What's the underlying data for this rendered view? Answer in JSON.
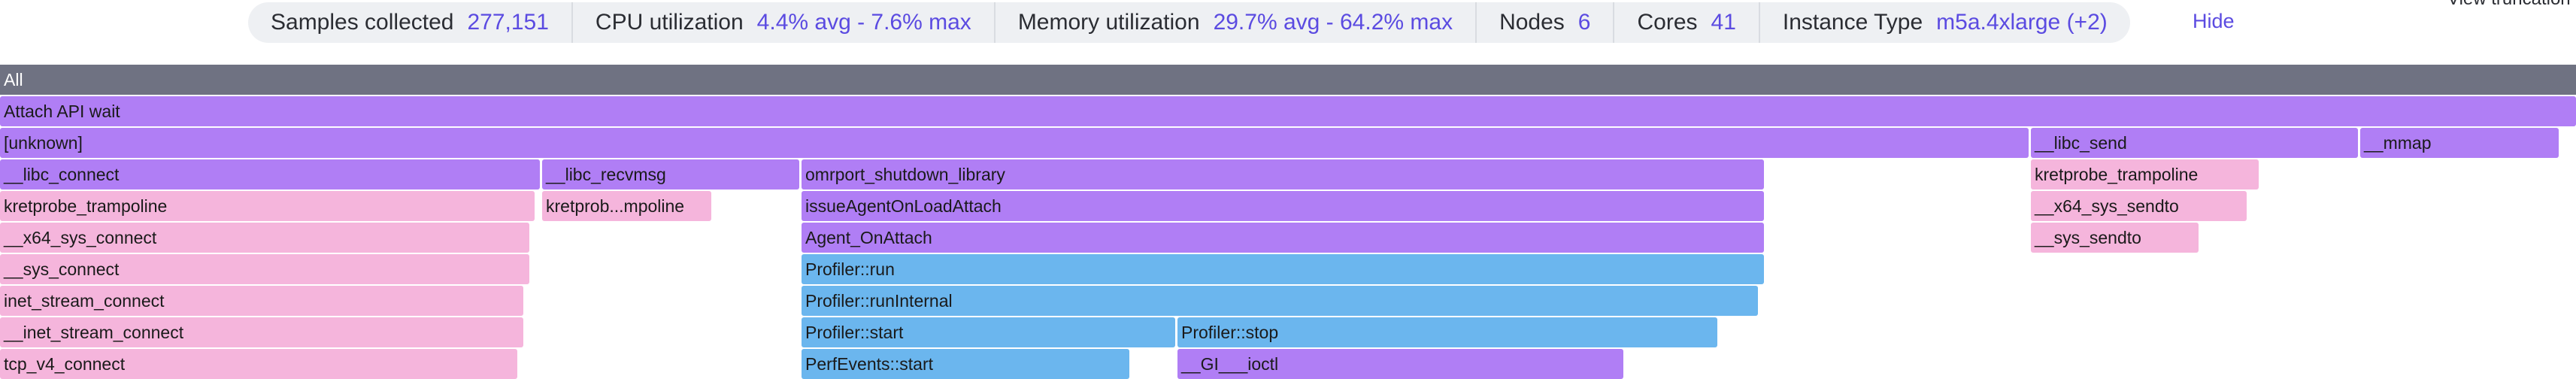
{
  "stats": [
    {
      "name": "samples",
      "label": "Samples collected",
      "value": "277,151"
    },
    {
      "name": "cpu",
      "label": "CPU utilization",
      "value": "4.4% avg - 7.6% max"
    },
    {
      "name": "memory",
      "label": "Memory utilization",
      "value": "29.7% avg - 64.2% max"
    },
    {
      "name": "nodes",
      "label": "Nodes",
      "value": "6"
    },
    {
      "name": "cores",
      "label": "Cores",
      "value": "41"
    },
    {
      "name": "instance-type",
      "label": "Instance Type",
      "value": "m5a.4xlarge (+2)"
    }
  ],
  "hide_label": "Hide",
  "view_truncation_label": "View truncation",
  "colors": {
    "root": "#6f7282",
    "purple": "#b07ef5",
    "pink": "#f5b5dc",
    "blue": "#6bb6ee",
    "accent": "#5b4be1"
  },
  "flamegraph": {
    "root": "All",
    "rows": [
      [
        {
          "label": "Attach API wait",
          "color": "purple"
        }
      ],
      [
        {
          "label": "[unknown]",
          "color": "purple"
        },
        {
          "label": "__libc_send",
          "color": "purple"
        },
        {
          "label": "__mmap",
          "color": "purple"
        }
      ],
      [
        {
          "label": "__libc_connect",
          "color": "purple"
        },
        {
          "label": "__libc_recvmsg",
          "color": "purple"
        },
        {
          "label": "omrport_shutdown_library",
          "color": "purple"
        },
        {
          "label": "kretprobe_trampoline",
          "color": "pink"
        }
      ],
      [
        {
          "label": "kretprobe_trampoline",
          "color": "pink"
        },
        {
          "label": "kretprob...mpoline",
          "color": "pink"
        },
        {
          "label": "issueAgentOnLoadAttach",
          "color": "purple"
        },
        {
          "label": "__x64_sys_sendto",
          "color": "pink"
        }
      ],
      [
        {
          "label": "__x64_sys_connect",
          "color": "pink"
        },
        {
          "label": "Agent_OnAttach",
          "color": "purple"
        },
        {
          "label": "__sys_sendto",
          "color": "pink"
        }
      ],
      [
        {
          "label": "__sys_connect",
          "color": "pink"
        },
        {
          "label": "Profiler::run",
          "color": "blue"
        }
      ],
      [
        {
          "label": "inet_stream_connect",
          "color": "pink"
        },
        {
          "label": "Profiler::runInternal",
          "color": "blue"
        }
      ],
      [
        {
          "label": "__inet_stream_connect",
          "color": "pink"
        },
        {
          "label": "Profiler::start",
          "color": "blue"
        },
        {
          "label": "Profiler::stop",
          "color": "blue"
        }
      ],
      [
        {
          "label": "tcp_v4_connect",
          "color": "pink"
        },
        {
          "label": "PerfEvents::start",
          "color": "blue"
        },
        {
          "label": "__GI___ioctl",
          "color": "purple"
        }
      ]
    ]
  }
}
